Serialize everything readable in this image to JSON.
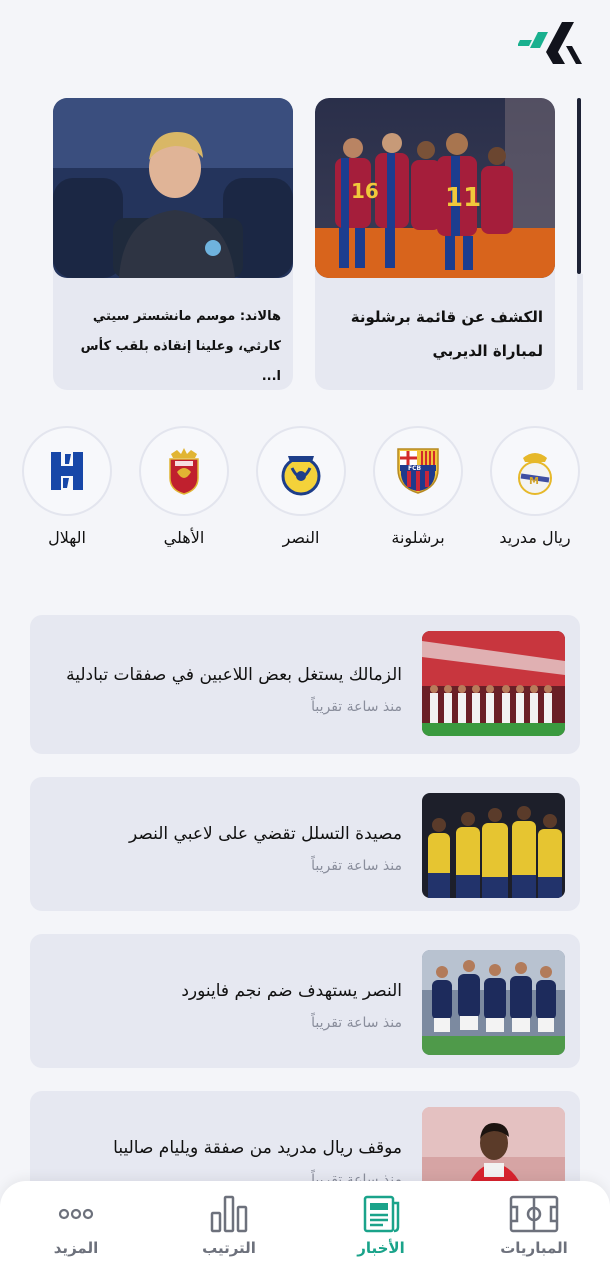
{
  "featured": [
    {
      "title": "الكشف عن قائمة برشلونة لمباراة الديربي"
    },
    {
      "title": "هالاند: موسم مانشستر سيتي كارثي، وعلينا إنقاذه بلقب كأس ا..."
    }
  ],
  "teams": [
    {
      "name": "ريال مدريد"
    },
    {
      "name": "برشلونة"
    },
    {
      "name": "النصر"
    },
    {
      "name": "الأهلي"
    },
    {
      "name": "الهلال"
    }
  ],
  "news": [
    {
      "title": "الزمالك يستغل بعض اللاعبين في صفقات تبادلية",
      "time": "منذ ساعة تقريباً"
    },
    {
      "title": "مصيدة التسلل تقضي على لاعبي النصر",
      "time": "منذ ساعة تقريباً"
    },
    {
      "title": "النصر يستهدف ضم نجم فاينورد",
      "time": "منذ ساعة تقريباً"
    },
    {
      "title": "موقف ريال مدريد من صفقة ويليام صاليبا",
      "time": "منذ ساعة تقريباً"
    }
  ],
  "nav": {
    "matches": "المباريات",
    "news": "الأخبار",
    "standings": "الترتيب",
    "more": "المزيد"
  },
  "colors": {
    "accent": "#1aa38a",
    "card_bg": "#e6e8f1",
    "page_bg": "#f4f5f9"
  }
}
